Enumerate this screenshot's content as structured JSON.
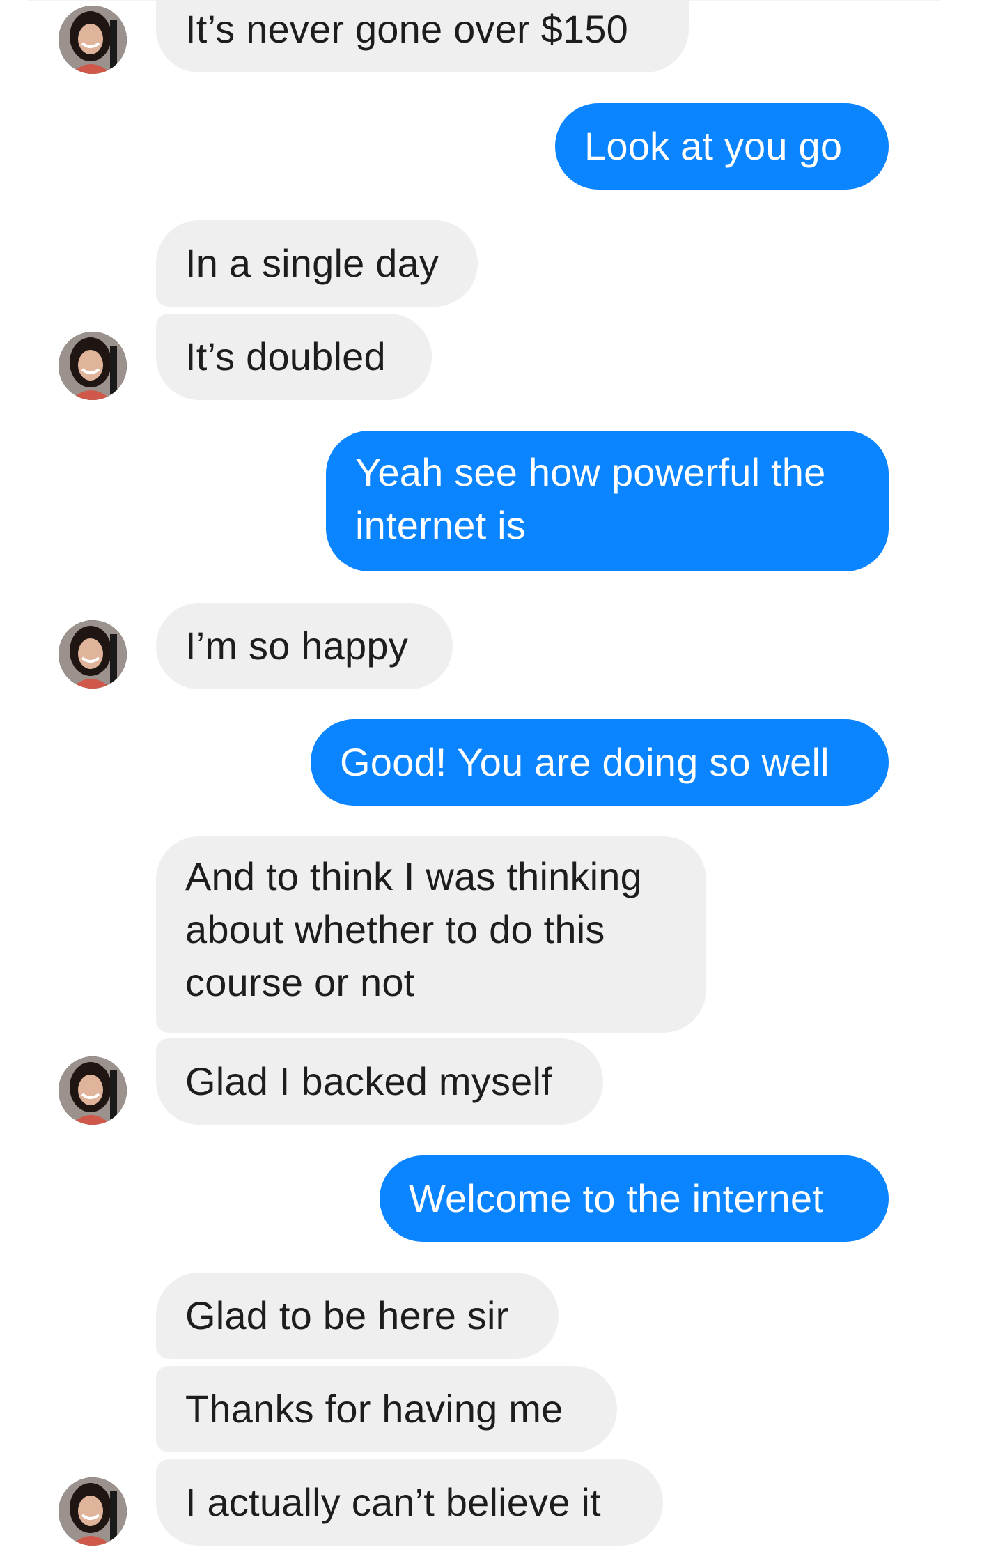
{
  "conversation": {
    "messages": [
      {
        "id": "m1",
        "side": "in",
        "text": "It’s never gone over $150"
      },
      {
        "id": "m2",
        "side": "out",
        "text": "Look at you go"
      },
      {
        "id": "m3",
        "side": "in",
        "text": "In a single day"
      },
      {
        "id": "m4",
        "side": "in",
        "text": "It’s doubled"
      },
      {
        "id": "m5",
        "side": "out",
        "text": "Yeah see how powerful the internet is"
      },
      {
        "id": "m6",
        "side": "in",
        "text": "I’m so happy"
      },
      {
        "id": "m7",
        "side": "out",
        "text": "Good! You are doing so well"
      },
      {
        "id": "m8",
        "side": "in",
        "text": "And to think I was thinking about whether to do this course or not"
      },
      {
        "id": "m9",
        "side": "in",
        "text": "Glad I backed myself"
      },
      {
        "id": "m10",
        "side": "out",
        "text": "Welcome to the internet"
      },
      {
        "id": "m11",
        "side": "in",
        "text": "Glad to be here sir"
      },
      {
        "id": "m12",
        "side": "in",
        "text": "Thanks for having me"
      },
      {
        "id": "m13",
        "side": "in",
        "text": "I actually can’t believe it"
      }
    ]
  },
  "colors": {
    "incoming_bubble": "#efefef",
    "outgoing_bubble": "#0a84ff",
    "incoming_text": "#1d1d1d",
    "outgoing_text": "#ffffff"
  },
  "icons": {
    "avatar": "contact-avatar-photo"
  }
}
